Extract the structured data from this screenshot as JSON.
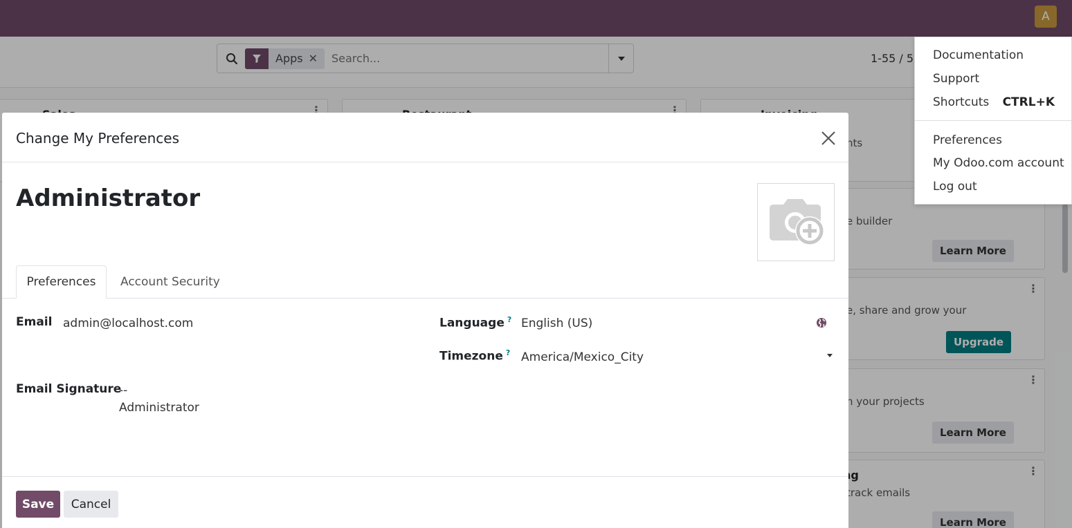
{
  "topbar": {
    "avatar_initial": "A"
  },
  "search": {
    "facet_label": "Apps",
    "facet_close": "✕",
    "placeholder": "Search...",
    "pager": "1-55 / 5"
  },
  "background_cards": {
    "card1_title": "Sales",
    "card2_title": "Restaurant",
    "card3_title": "Invoicing",
    "card3_desc": "nts",
    "card4_desc": "e builder",
    "card4_button": "Learn More",
    "card5_desc": "e, share and grow your",
    "card5_button": "Upgrade",
    "card6_desc": "n your projects",
    "card6_button": "Learn More",
    "card7_title": "ng",
    "card7_desc": "track emails",
    "card7_button": "Learn More"
  },
  "user_menu": {
    "items": [
      "Documentation",
      "Support",
      "Shortcuts",
      "Preferences",
      "My Odoo.com account",
      "Log out"
    ],
    "shortcut_key": "CTRL+K"
  },
  "modal": {
    "title": "Change My Preferences",
    "user_name": "Administrator",
    "tabs": [
      {
        "label": "Preferences",
        "active": true
      },
      {
        "label": "Account Security",
        "active": false
      }
    ],
    "fields": {
      "email_label": "Email",
      "email_value": "admin@localhost.com",
      "signature_label": "Email Signature",
      "signature_line1": "--",
      "signature_line2": "Administrator",
      "language_label": "Language",
      "language_value": "English (US)",
      "timezone_label": "Timezone",
      "timezone_value": "America/Mexico_City",
      "help_mark": "?"
    },
    "buttons": {
      "save": "Save",
      "cancel": "Cancel"
    }
  },
  "colors": {
    "brand": "#714b67",
    "teal": "#017e84",
    "avatar": "#c9983f"
  }
}
